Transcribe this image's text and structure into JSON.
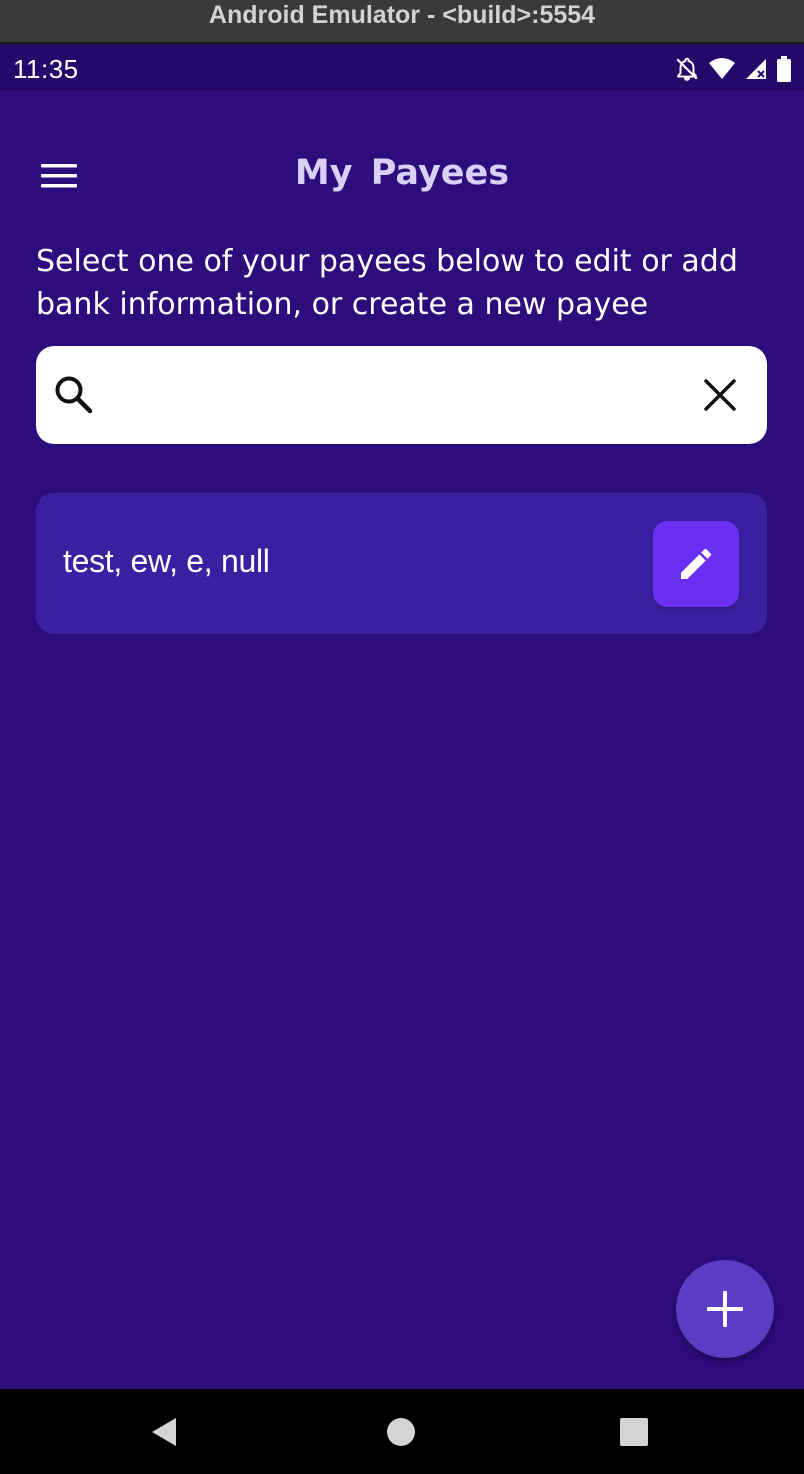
{
  "emulator": {
    "title": "Android Emulator - <build>:5554"
  },
  "status_bar": {
    "time": "11:35",
    "icons": [
      "notifications-off-icon",
      "wifi-icon",
      "signal-icon",
      "battery-icon"
    ]
  },
  "header": {
    "menu_icon": "hamburger-menu-icon",
    "title": "My  Payees"
  },
  "subtitle": "Select one of your payees below to edit or add bank information, or create a new payee",
  "search": {
    "value": "",
    "placeholder": "",
    "search_icon": "search-icon",
    "clear_icon": "close-icon"
  },
  "payees": [
    {
      "name": "test, ew, e, null",
      "action_icon": "edit-pencil-icon"
    }
  ],
  "fab": {
    "icon": "plus-icon"
  },
  "nav_bar": {
    "icons": [
      "back-triangle-icon",
      "home-circle-icon",
      "recents-square-icon"
    ]
  },
  "colors": {
    "background": "#2d0c7c",
    "status_bar": "#24096a",
    "card": "#3b1fa1",
    "edit_button": "#6a2ff0",
    "fab": "#5b3cc4",
    "title": "#d8d0f7"
  }
}
